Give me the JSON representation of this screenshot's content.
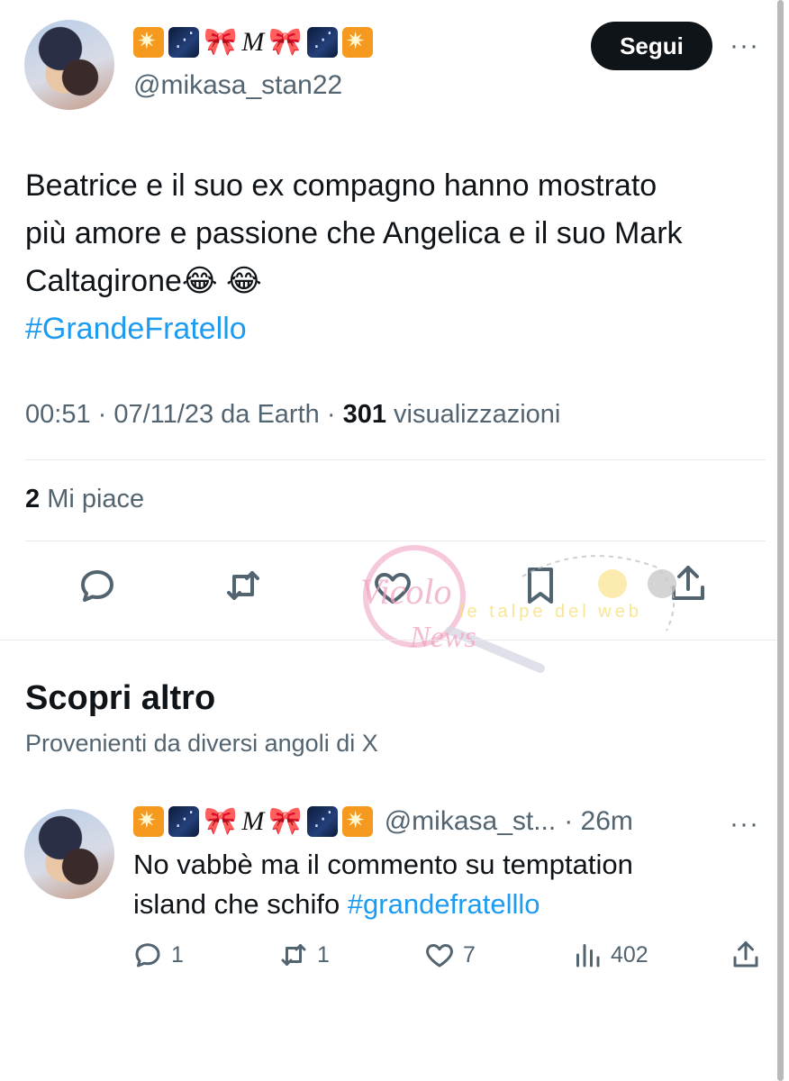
{
  "tweet": {
    "display_name_letter": "M",
    "handle": "@mikasa_stan22",
    "follow_label": "Segui",
    "text_line1": "Beatrice e il suo ex compagno hanno mostrato",
    "text_line2": "più amore e passione che Angelica e il suo Mark",
    "text_line3": "Caltagirone😂 😂",
    "hashtag": "#GrandeFratello",
    "time": "00:51",
    "date": "07/11/23 da Earth",
    "views_count": "301",
    "views_label": "visualizzazioni",
    "likes_count": "2",
    "likes_label": "Mi piace"
  },
  "discover": {
    "title": "Scopri altro",
    "subtitle": "Provenienti da diversi angoli di X"
  },
  "reply": {
    "display_name_letter": "M",
    "handle": "@mikasa_st...",
    "time": "· 26m",
    "text_line1": "No vabbè ma il commento su temptation",
    "text_line2_prefix": "island che schifo ",
    "hashtag": "#grandefratelllo",
    "replies": "1",
    "reposts": "1",
    "likes": "7",
    "views": "402"
  },
  "icons": [
    "reply-icon",
    "repost-icon",
    "like-icon",
    "bookmark-icon",
    "share-icon",
    "views-icon",
    "more-icon"
  ],
  "colors": {
    "link": "#1d9bf0",
    "muted": "#536471",
    "text": "#0f1419",
    "button_bg": "#0f1419"
  }
}
